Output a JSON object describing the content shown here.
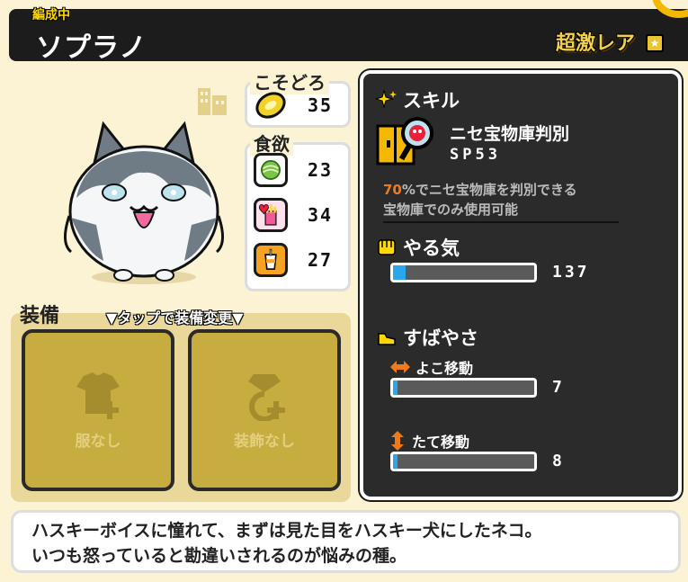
{
  "header": {
    "status_tag": "編成中",
    "unit_name": "ソプラノ",
    "rarity": "超激レア",
    "rarity_badge": "★",
    "accent": "#f5b800"
  },
  "stats": {
    "stealth": {
      "title": "こそどろ",
      "value": "35"
    },
    "appetite": {
      "title": "食欲",
      "items": [
        {
          "icon": "lettuce-food-icon",
          "value": "23"
        },
        {
          "icon": "heart-fries-icon",
          "value": "34"
        },
        {
          "icon": "drink-cup-icon",
          "value": "27"
        }
      ]
    }
  },
  "equipment": {
    "title": "装備",
    "hint": "▼タップで装備変更▼",
    "slots": [
      {
        "label": "服なし",
        "icon": "shirt-plus-icon"
      },
      {
        "label": "装飾なし",
        "icon": "gem-plus-icon"
      }
    ]
  },
  "skill": {
    "heading": "スキル",
    "name": "ニセ宝物庫判別",
    "sp": "SP53",
    "percent": "70",
    "desc_line1": "%でニセ宝物庫を判別できる",
    "desc_line2": "宝物庫でのみ使用可能",
    "percent_color": "#f07a1a"
  },
  "motivation": {
    "heading": "やる気",
    "value": "137",
    "fill": 0.09
  },
  "speed": {
    "heading": "すばやさ",
    "horizontal": {
      "label": "よこ移動",
      "value": "7",
      "fill": 0.03
    },
    "vertical": {
      "label": "たて移動",
      "value": "8",
      "fill": 0.03
    }
  },
  "description": {
    "line1": "ハスキーボイスに憧れて、まずは見た目をハスキー犬にしたネコ。",
    "line2": "いつも怒っていると勘違いされるのが悩みの種。"
  }
}
